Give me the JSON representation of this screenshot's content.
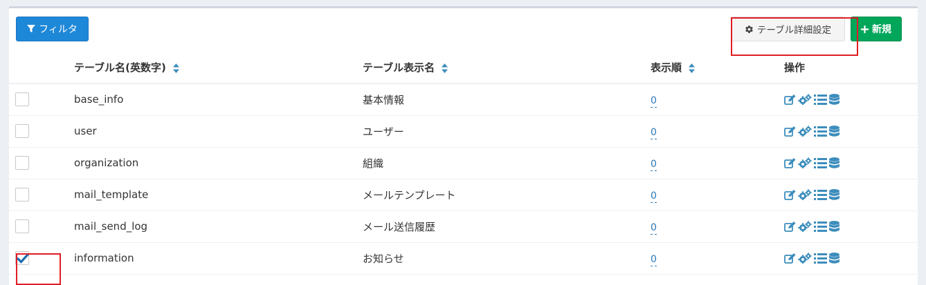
{
  "toolbar": {
    "filter_label": "フィルタ",
    "settings_label": "テーブル詳細設定",
    "new_label": "新規"
  },
  "table": {
    "headers": {
      "name": "テーブル名(英数字)",
      "display_name": "テーブル表示名",
      "order": "表示順",
      "actions": "操作"
    },
    "rows": [
      {
        "name": "base_info",
        "display_name": "基本情報",
        "order": "0",
        "checked": false
      },
      {
        "name": "user",
        "display_name": "ユーザー",
        "order": "0",
        "checked": false
      },
      {
        "name": "organization",
        "display_name": "組織",
        "order": "0",
        "checked": false
      },
      {
        "name": "mail_template",
        "display_name": "メールテンプレート",
        "order": "0",
        "checked": false
      },
      {
        "name": "mail_send_log",
        "display_name": "メール送信履歴",
        "order": "0",
        "checked": false
      },
      {
        "name": "information",
        "display_name": "お知らせ",
        "order": "0",
        "checked": true
      }
    ]
  },
  "icons": [
    "edit-icon",
    "cogs-icon",
    "list-icon",
    "database-icon"
  ],
  "colors": {
    "primary": "#1e88d8",
    "success": "#00a65a",
    "link": "#2a78b8",
    "highlight": "#e01b24"
  }
}
